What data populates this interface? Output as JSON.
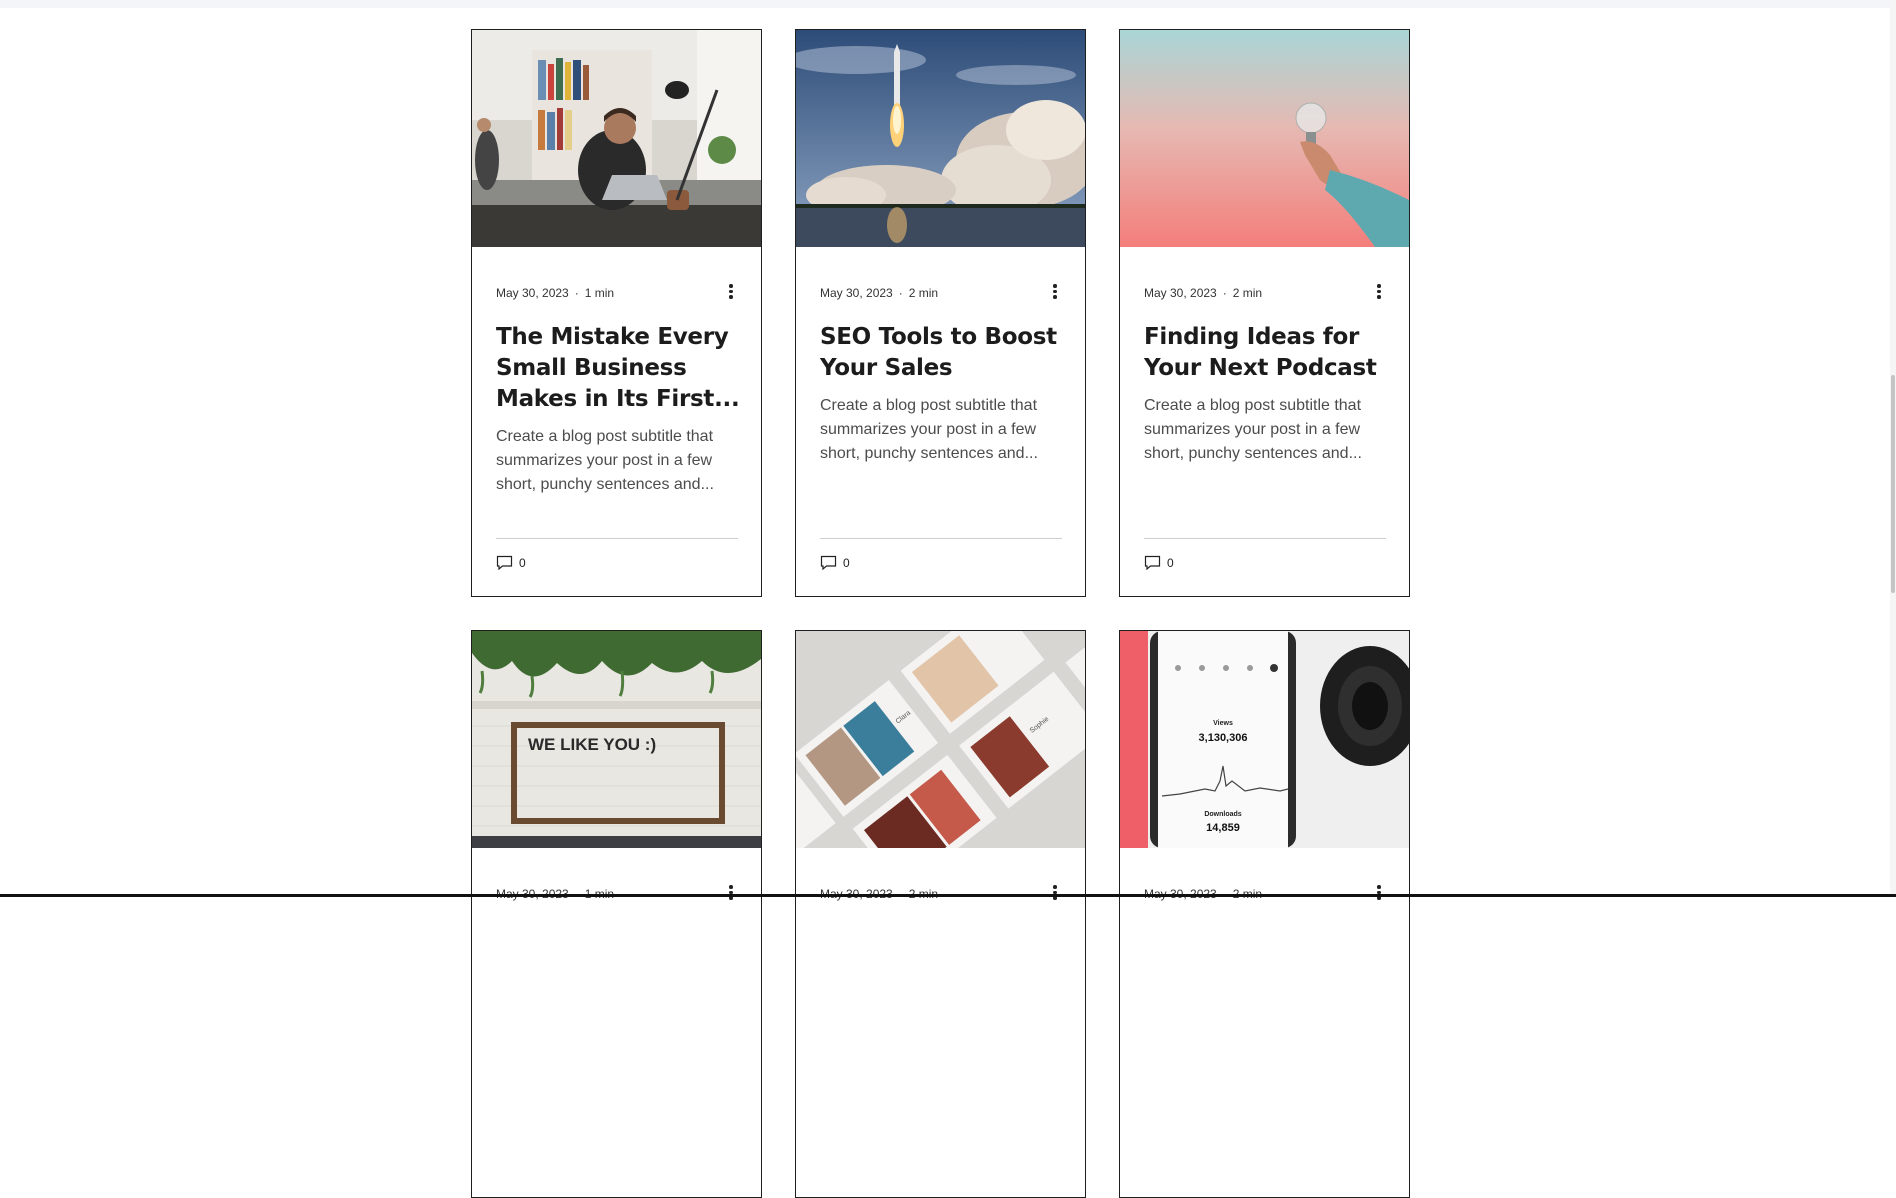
{
  "posts": [
    {
      "date": "May 30, 2023",
      "read_time": "1 min",
      "title": "The Mistake Every Small Business Makes in Its First...",
      "excerpt": "Create a blog post subtitle that summarizes your post in a few short, punchy sentences and...",
      "comments": "0",
      "image": "man-at-laptop-office"
    },
    {
      "date": "May 30, 2023",
      "read_time": "2 min",
      "title": "SEO Tools to Boost Your Sales",
      "excerpt": "Create a blog post subtitle that summarizes your post in a few short, punchy sentences and...",
      "comments": "0",
      "image": "rocket-launch"
    },
    {
      "date": "May 30, 2023",
      "read_time": "2 min",
      "title": "Finding Ideas for Your Next Podcast",
      "excerpt": "Create a blog post subtitle that summarizes your post in a few short, punchy sentences and...",
      "comments": "0",
      "image": "hand-holding-lightbulb"
    },
    {
      "date": "May 30, 2023",
      "read_time": "1 min",
      "image": "we-like-you-sign",
      "sign_text": "WE LIKE YOU :)"
    },
    {
      "date": "May 30, 2023",
      "read_time": "2 min",
      "image": "fashion-portfolio-cards",
      "card_labels": [
        "Clara",
        "Sophie"
      ]
    },
    {
      "date": "May 30, 2023",
      "read_time": "2 min",
      "image": "phone-analytics",
      "phone": {
        "views_label": "Views",
        "views": "3,130,306",
        "downloads_label": "Downloads",
        "downloads": "14,859"
      }
    }
  ],
  "colors": {
    "title": "#1c1c1c",
    "excerpt": "#4c4c4c",
    "border": "#1f1f1f"
  }
}
